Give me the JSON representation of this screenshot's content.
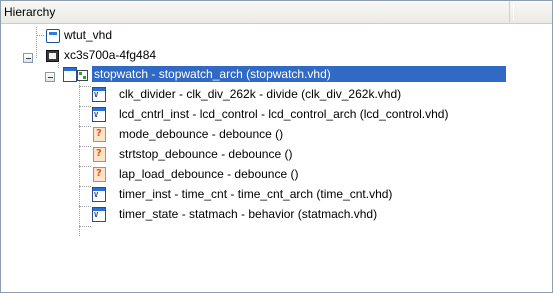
{
  "panel": {
    "title": "Hierarchy"
  },
  "tree": {
    "root_items": [
      {
        "label": "wtut_vhd",
        "icon": "document-icon"
      },
      {
        "label": "xc3s700a-4fg484",
        "icon": "chip-icon",
        "expanded": true
      }
    ],
    "top_module": {
      "label": "stopwatch - stopwatch_arch (stopwatch.vhd)",
      "icon": "vhdl-module-icon",
      "expanded": true,
      "selected": true
    },
    "children": [
      {
        "label": "clk_divider - clk_div_262k - divide (clk_div_262k.vhd)",
        "icon": "vhdl-module-icon"
      },
      {
        "label": "lcd_cntrl_inst - lcd_control - lcd_control_arch (lcd_control.vhd)",
        "icon": "vhdl-module-icon"
      },
      {
        "label": "mode_debounce - debounce ()",
        "icon": "unknown-module-icon"
      },
      {
        "label": "strtstop_debounce - debounce ()",
        "icon": "unknown-module-icon"
      },
      {
        "label": "lap_load_debounce - debounce ()",
        "icon": "unknown-module-icon"
      },
      {
        "label": "timer_inst - time_cnt - time_cnt_arch (time_cnt.vhd)",
        "icon": "vhdl-module-icon"
      },
      {
        "label": "timer_state - statmach - behavior (statmach.vhd)",
        "icon": "vhdl-module-icon"
      }
    ]
  },
  "colors": {
    "selection": "#316ac5",
    "border": "#8e9eae"
  }
}
